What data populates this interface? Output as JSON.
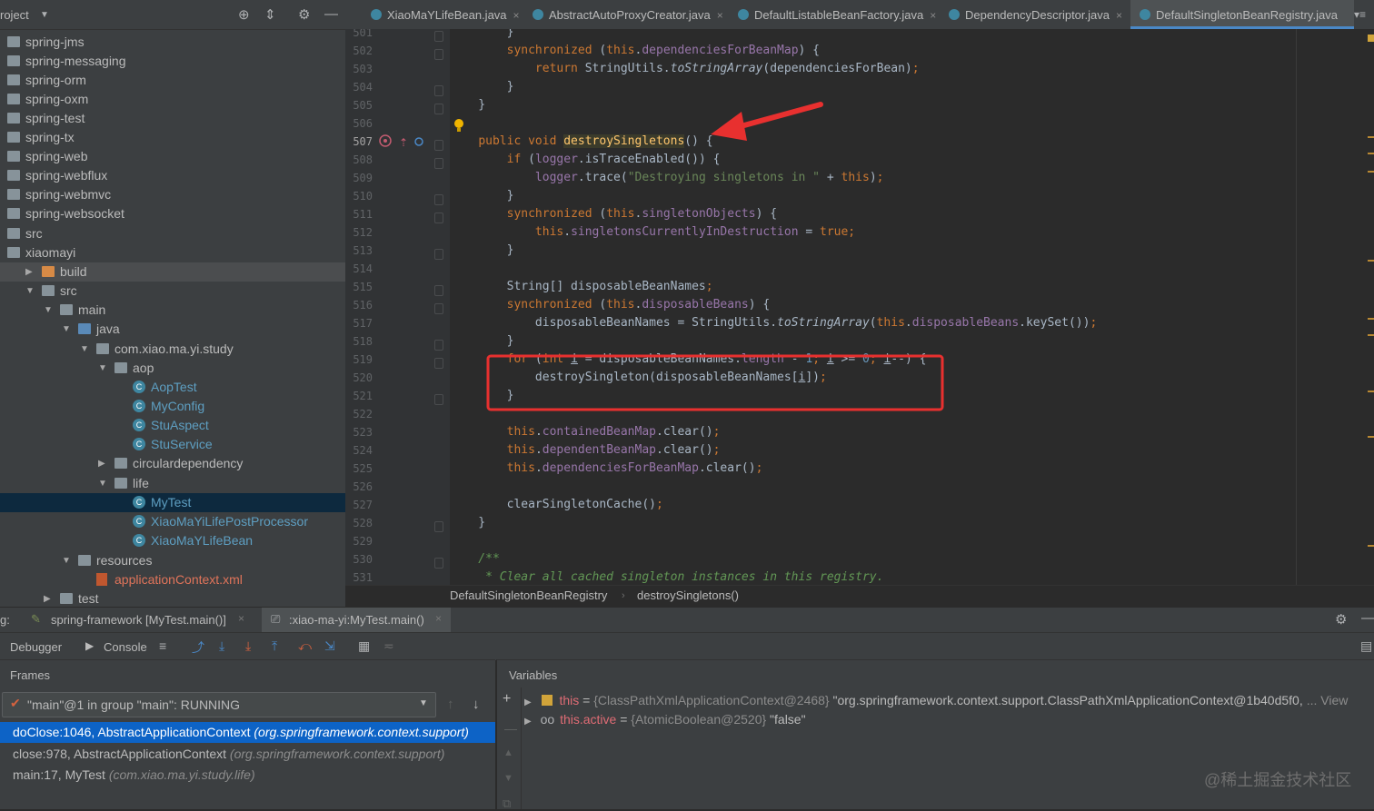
{
  "project": {
    "title": "roject",
    "items": [
      {
        "label": "spring-jms",
        "type": "module"
      },
      {
        "label": "spring-messaging",
        "type": "module"
      },
      {
        "label": "spring-orm",
        "type": "module"
      },
      {
        "label": "spring-oxm",
        "type": "module"
      },
      {
        "label": "spring-test",
        "type": "module"
      },
      {
        "label": "spring-tx",
        "type": "module"
      },
      {
        "label": "spring-web",
        "type": "module"
      },
      {
        "label": "spring-webflux",
        "type": "module"
      },
      {
        "label": "spring-webmvc",
        "type": "module"
      },
      {
        "label": "spring-websocket",
        "type": "module"
      },
      {
        "label": "src",
        "type": "folder"
      },
      {
        "label": "xiaomayi",
        "type": "module"
      },
      {
        "label": "build",
        "type": "folder-orange"
      },
      {
        "label": "src",
        "type": "folder"
      },
      {
        "label": "main",
        "type": "folder"
      },
      {
        "label": "java",
        "type": "folder-blue"
      },
      {
        "label": "com.xiao.ma.yi.study",
        "type": "package"
      },
      {
        "label": "aop",
        "type": "package"
      },
      {
        "label": "AopTest",
        "type": "class"
      },
      {
        "label": "MyConfig",
        "type": "class"
      },
      {
        "label": "StuAspect",
        "type": "class"
      },
      {
        "label": "StuService",
        "type": "class"
      },
      {
        "label": "circulardependency",
        "type": "package"
      },
      {
        "label": "life",
        "type": "package"
      },
      {
        "label": "MyTest",
        "type": "class"
      },
      {
        "label": "XiaoMaYiLifePostProcessor",
        "type": "class"
      },
      {
        "label": "XiaoMaYLifeBean",
        "type": "class"
      },
      {
        "label": "resources",
        "type": "folder"
      },
      {
        "label": "applicationContext.xml",
        "type": "xml"
      },
      {
        "label": "test",
        "type": "folder"
      }
    ]
  },
  "tabs": [
    {
      "label": "XiaoMaYLifeBean.java"
    },
    {
      "label": "AbstractAutoProxyCreator.java"
    },
    {
      "label": "DefaultListableBeanFactory.java"
    },
    {
      "label": "DependencyDescriptor.java"
    },
    {
      "label": "DefaultSingletonBeanRegistry.java"
    }
  ],
  "editor": {
    "line_numbers": [
      "501",
      "502",
      "503",
      "504",
      "505",
      "506",
      "507",
      "508",
      "509",
      "510",
      "511",
      "512",
      "513",
      "514",
      "515",
      "516",
      "517",
      "518",
      "519",
      "520",
      "521",
      "522",
      "523",
      "524",
      "525",
      "526",
      "527",
      "528",
      "529",
      "530",
      "531"
    ]
  },
  "breadcrumb": {
    "class_name": "DefaultSingletonBeanRegistry",
    "method_name": "destroySingletons()"
  },
  "debug": {
    "label_prefix": "g:",
    "sessions": [
      {
        "label": "spring-framework [MyTest.main()]"
      },
      {
        "label": ":xiao-ma-yi:MyTest.main()"
      }
    ],
    "debugger_tab": "Debugger",
    "console_tab": "Console",
    "frames_title": "Frames",
    "thread": "\"main\"@1 in group \"main\": RUNNING",
    "frames": [
      {
        "method": "doClose:1046, AbstractApplicationContext",
        "package": "(org.springframework.context.support)"
      },
      {
        "method": "close:978, AbstractApplicationContext",
        "package": "(org.springframework.context.support)"
      },
      {
        "method": "main:17, MyTest",
        "package": "(com.xiao.ma.yi.study.life)"
      }
    ],
    "variables_title": "Variables",
    "variables": [
      {
        "name": "this",
        "eq": " = ",
        "type": "{ClassPathXmlApplicationContext@2468}",
        "value": " \"org.springframework.context.support.ClassPathXmlApplicationContext@1b40d5f0,",
        "more": "... View"
      },
      {
        "name": "this.active",
        "eq": " = ",
        "type": "{AtomicBoolean@2520}",
        "value": " \"false\"",
        "more": ""
      }
    ]
  },
  "watermark": "@稀土掘金技术社区",
  "colors": {
    "accent": "#4a88c7",
    "selection": "#0d63c6",
    "annotation_red": "#e8302f"
  }
}
